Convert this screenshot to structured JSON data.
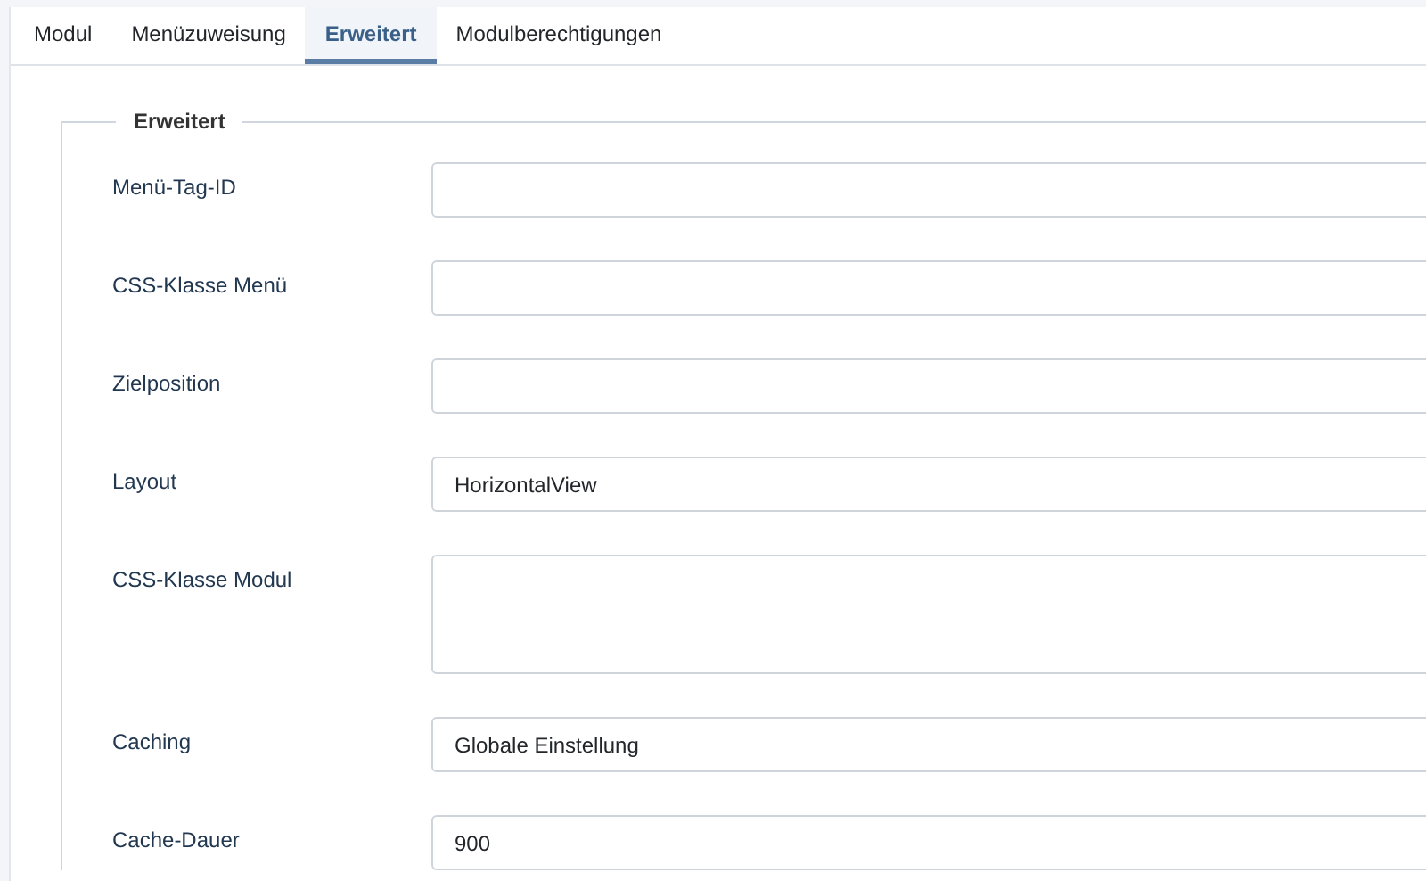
{
  "tabs": [
    {
      "label": "Modul",
      "selected": false
    },
    {
      "label": "Menüzuweisung",
      "selected": false
    },
    {
      "label": "Erweitert",
      "selected": true
    },
    {
      "label": "Modulberechtigungen",
      "selected": false
    }
  ],
  "fieldset": {
    "legend": "Erweitert",
    "fields": [
      {
        "label": "Menü-Tag-ID",
        "kind": "text"
      },
      {
        "label": "CSS-Klasse Menü",
        "kind": "text"
      },
      {
        "label": "Zielposition",
        "kind": "text"
      },
      {
        "label": "Layout",
        "kind": "select",
        "value": "HorizontalView"
      },
      {
        "label": "CSS-Klasse Modul",
        "kind": "textarea"
      },
      {
        "label": "Caching",
        "kind": "select",
        "value": "Globale Einstellung"
      },
      {
        "label": "Cache-Dauer",
        "kind": "text",
        "value": "900"
      }
    ]
  }
}
